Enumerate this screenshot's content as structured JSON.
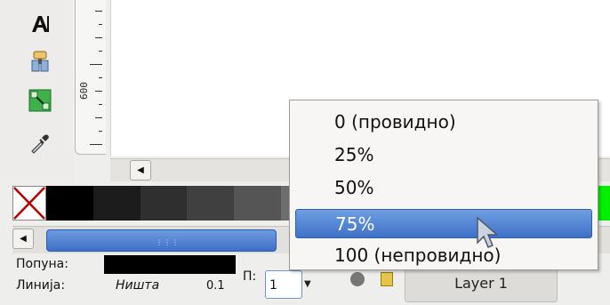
{
  "toolbox": {
    "tools": [
      {
        "name": "text-tool",
        "glyph": "A"
      },
      {
        "name": "spray-tool",
        "glyph": "◆"
      },
      {
        "name": "connector-tool",
        "glyph": "↘"
      },
      {
        "name": "dropper-tool",
        "glyph": "✎"
      }
    ]
  },
  "ruler": {
    "label": "600"
  },
  "palette": {
    "none_swatch": "X",
    "colors": [
      "#000000",
      "#1c1c1c",
      "#2f2f2f",
      "#404040",
      "#555555",
      "#6d6d6d",
      "#868686",
      "#a2a2a2",
      "#c0c0c0",
      "#d9d9d9",
      "#00c000",
      "#00f000"
    ]
  },
  "status": {
    "fill_label": "Попуна:",
    "stroke_label": "Линија:",
    "stroke_value": "Ништа",
    "stroke_width": "0.1",
    "opacity_label": "П:",
    "opacity_value": "1",
    "layer_label": "Layer 1"
  },
  "menu": {
    "items": [
      "0 (провидно)",
      "25%",
      "50%",
      "75%",
      "100 (непровидно)"
    ],
    "selected_index": 3
  },
  "colors": {
    "accent": "#4a7cd0",
    "selection_text": "#ffffff"
  }
}
